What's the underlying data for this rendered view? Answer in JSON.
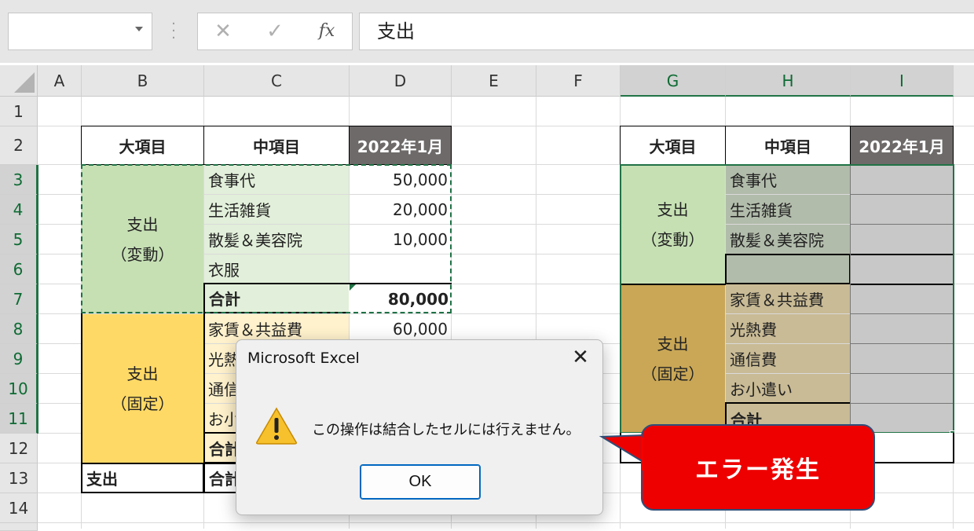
{
  "formula_bar": {
    "name_box": "",
    "cancel_icon": "✕",
    "enter_icon": "✓",
    "fx_icon": "fx",
    "formula": "支出"
  },
  "columns": [
    "A",
    "B",
    "C",
    "D",
    "E",
    "F",
    "G",
    "H",
    "I"
  ],
  "rows": [
    "1",
    "2",
    "3",
    "4",
    "5",
    "6",
    "7",
    "8",
    "9",
    "10",
    "11",
    "12",
    "13",
    "14"
  ],
  "left_table": {
    "header": {
      "major": "大項目",
      "middle": "中項目",
      "month": "2022年1月"
    },
    "group_variable": {
      "label_line1": "支出",
      "label_line2": "（変動）"
    },
    "group_fixed": {
      "label_line1": "支出",
      "label_line2": "（固定）"
    },
    "items": [
      {
        "name": "食事代",
        "value": "50,000"
      },
      {
        "name": "生活雑貨",
        "value": "20,000"
      },
      {
        "name": "散髪＆美容院",
        "value": "10,000"
      },
      {
        "name": "衣服",
        "value": ""
      },
      {
        "name": "合計",
        "value": "80,000"
      },
      {
        "name": "家賃＆共益費",
        "value": "60,000"
      },
      {
        "name": "光熱",
        "value": ""
      },
      {
        "name": "通信",
        "value": ""
      },
      {
        "name": "お小",
        "value": ""
      },
      {
        "name": "合計",
        "value": ""
      }
    ],
    "footer": {
      "label": "支出",
      "middle": "合計"
    }
  },
  "right_table": {
    "header": {
      "major": "大項目",
      "middle": "中項目",
      "month": "2022年1月"
    },
    "group_variable": {
      "label_line1": "支出",
      "label_line2": "（変動）"
    },
    "group_fixed": {
      "label_line1": "支出",
      "label_line2": "（固定）"
    },
    "items": [
      "食事代",
      "生活雑貨",
      "散髪＆美容院",
      "",
      "家賃＆共益費",
      "光熱費",
      "通信費",
      "お小遣い",
      "合計"
    ]
  },
  "dialog": {
    "title": "Microsoft Excel",
    "close_icon": "✕",
    "warning_icon": "warning-triangle",
    "message": "この操作は結合したセルには行えません。",
    "ok_label": "OK"
  },
  "callout": {
    "text": "エラー発生"
  },
  "colors": {
    "light_green": "#e2efda",
    "green": "#c6e0b4",
    "light_yellow": "#fff2cc",
    "yellow": "#ffd966",
    "header_gray": "#6e6a6a",
    "selection_green": "#217346",
    "callout_red": "#ee0000"
  }
}
